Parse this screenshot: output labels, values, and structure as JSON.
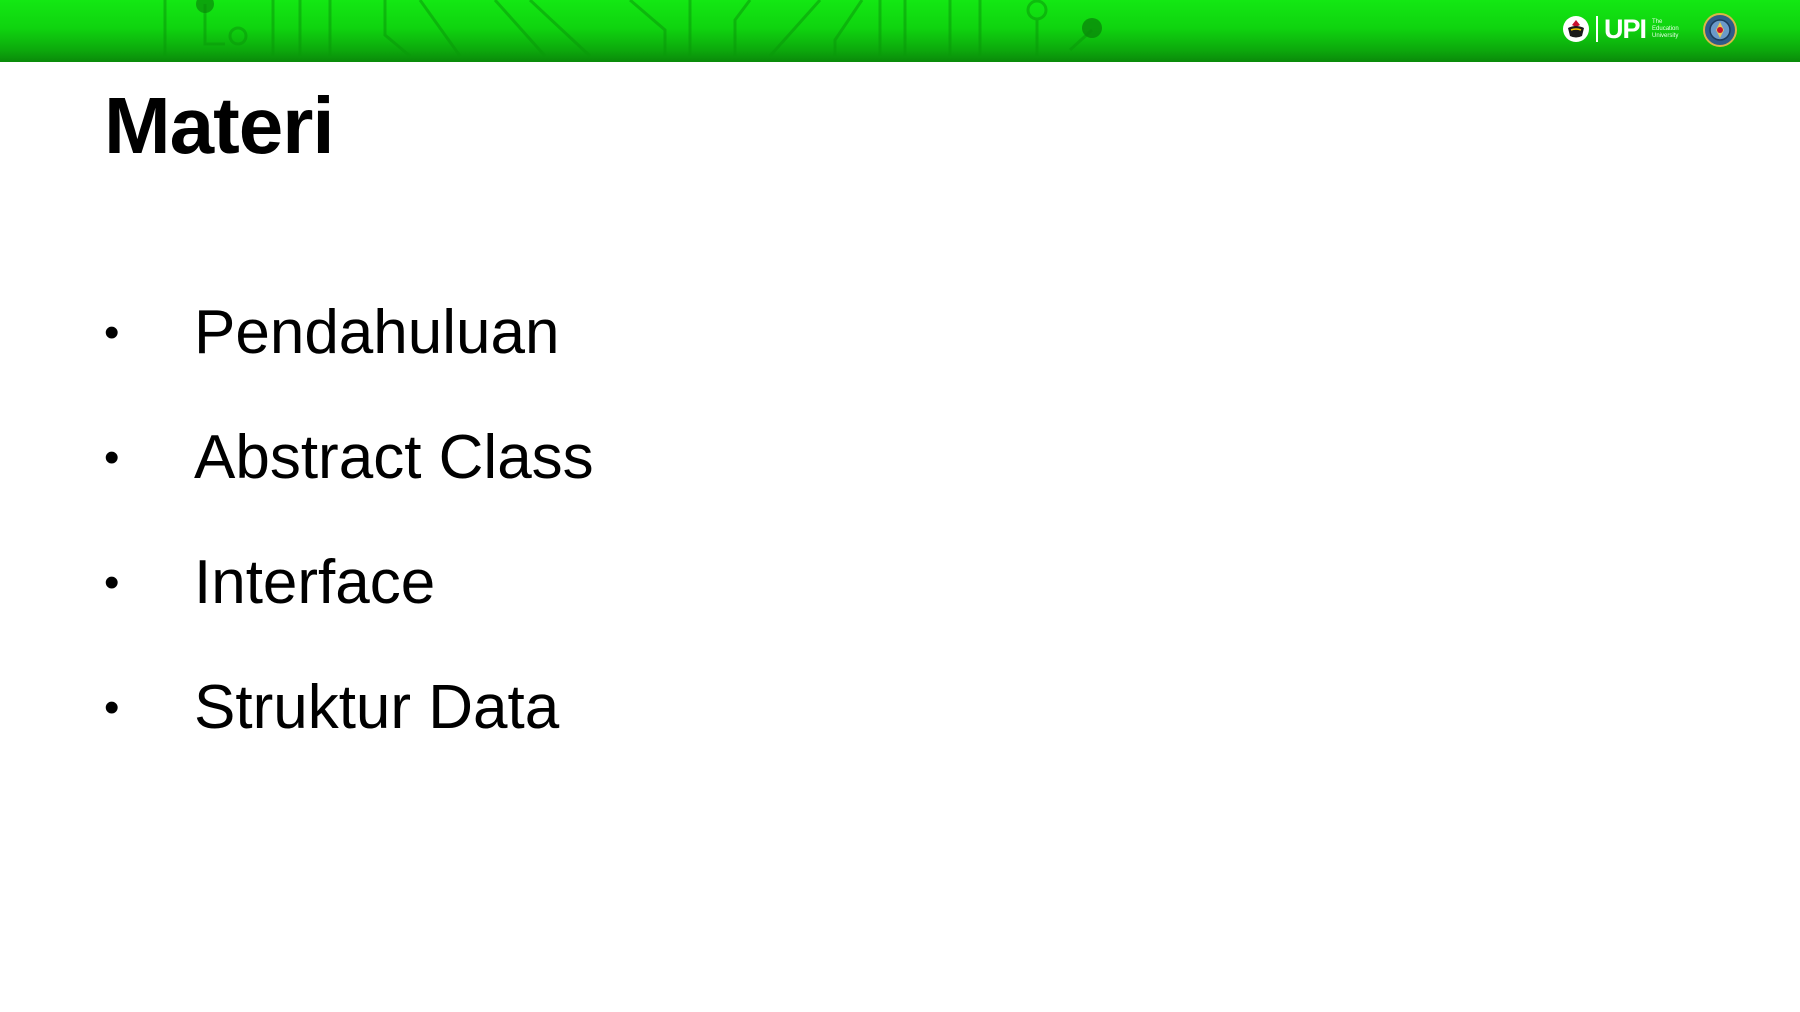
{
  "header": {
    "logo_text": "UPI",
    "logo_tagline": [
      "The",
      "Education",
      "University"
    ],
    "banner_color": "#13e813",
    "banner_dark_color": "#0a8a0a",
    "logo_icon": "upi-emblem-icon",
    "seal_icon": "institution-seal-icon"
  },
  "slide": {
    "title": "Materi",
    "bullet_glyph": "•",
    "bullets": [
      {
        "label": "Pendahuluan"
      },
      {
        "label": "Abstract Class"
      },
      {
        "label": "Interface"
      },
      {
        "label": "Struktur Data"
      }
    ]
  }
}
